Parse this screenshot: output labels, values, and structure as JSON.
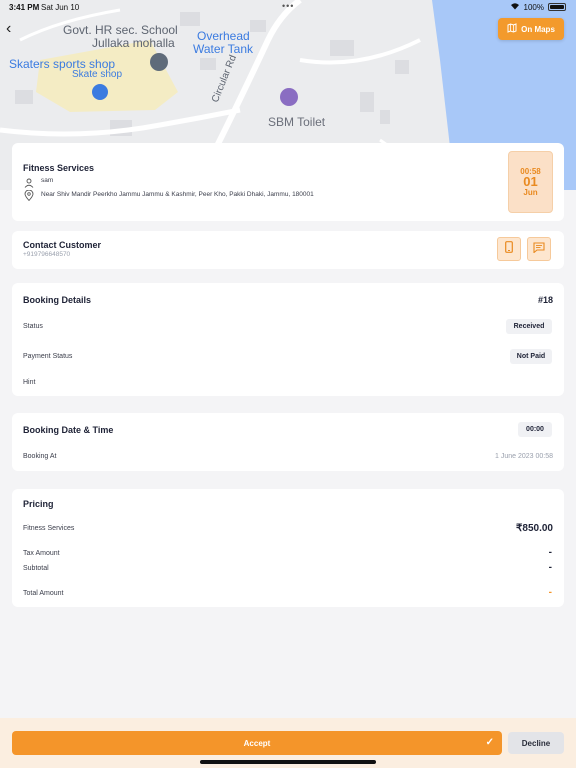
{
  "status_bar": {
    "time": "3:41 PM",
    "date": "Sat Jun 10",
    "battery": "100%"
  },
  "map": {
    "labels": {
      "school_line1": "Govt. HR sec. School",
      "school_line2": "Jullaka mohalla",
      "tank_line1": "Overhead",
      "tank_line2": "Water Tank",
      "skaters": "Skaters sports shop",
      "skate": "Skate shop",
      "road": "Circular Rd",
      "toilet": "SBM Toilet"
    },
    "button_label": "On Maps",
    "colors": {
      "water": "#a8c8f8",
      "land": "#ebecee",
      "label_blue": "#3b7be0"
    }
  },
  "service": {
    "title": "Fitness Services",
    "user": "sam",
    "address": "Near Shiv Mandir Peerkho Jammu Jammu & Kashmir, Peer Kho, Pakki Dhaki, Jammu, 180001",
    "time": "00:58",
    "day": "01",
    "month": "Jun"
  },
  "contact": {
    "title": "Contact Customer",
    "phone": "+919796648570"
  },
  "booking": {
    "title": "Booking Details",
    "id": "#18",
    "status_label": "Status",
    "status_value": "Received",
    "payment_label": "Payment Status",
    "payment_value": "Not Paid",
    "hint_label": "Hint"
  },
  "datetime": {
    "title": "Booking Date & Time",
    "time_value": "00:00",
    "booking_at_label": "Booking At",
    "booking_at_value": "1 June 2023 00:58"
  },
  "pricing": {
    "title": "Pricing",
    "service_label": "Fitness Services",
    "service_value": "₹850.00",
    "tax_label": "Tax Amount",
    "tax_value": "-",
    "subtotal_label": "Subtotal",
    "subtotal_value": "-",
    "total_label": "Total Amount",
    "total_value": "-"
  },
  "actions": {
    "accept": "Accept",
    "decline": "Decline"
  },
  "colors": {
    "accent": "#f4952a",
    "accent_light": "#fde6cf"
  }
}
